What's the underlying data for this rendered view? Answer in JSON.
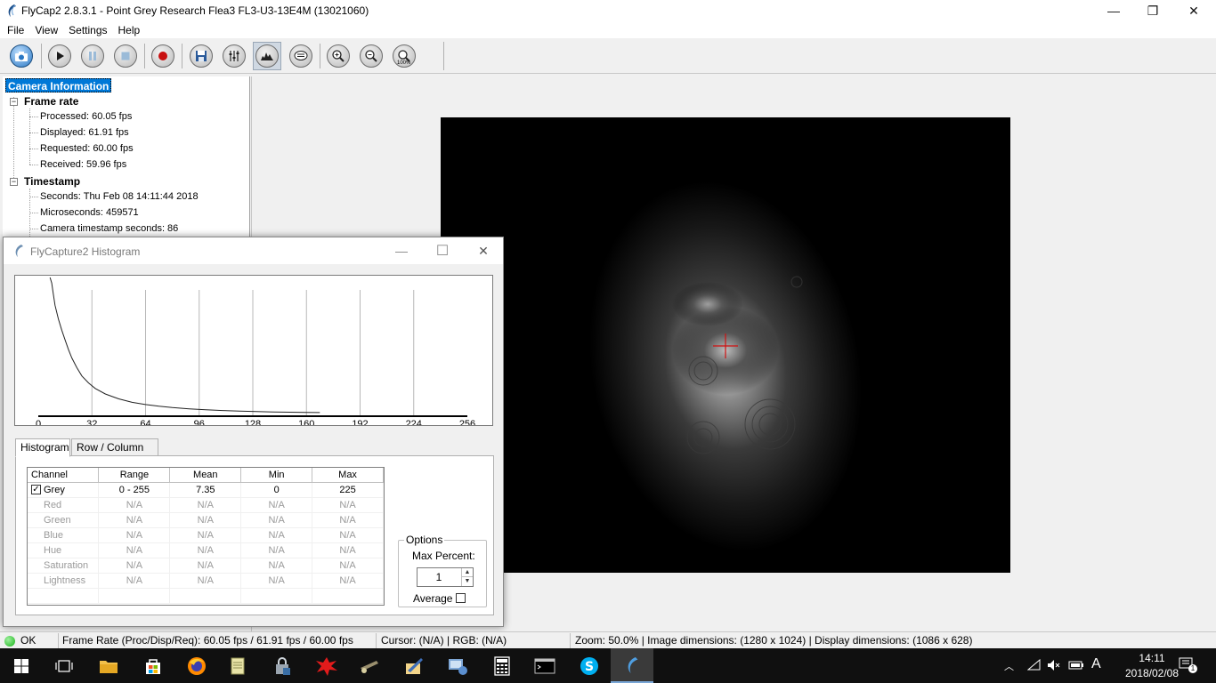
{
  "window": {
    "title": "FlyCap2 2.8.3.1 - Point Grey Research Flea3 FL3-U3-13E4M (13021060)",
    "minimize": "—",
    "maximize": "❐",
    "close": "✕"
  },
  "menu": [
    "File",
    "View",
    "Settings",
    "Help"
  ],
  "toolbar": [
    "camera-select",
    "start",
    "pause",
    "stop",
    "record",
    "save",
    "settings",
    "histogram",
    "event-stats",
    "zoom-in",
    "zoom-out",
    "zoom-100"
  ],
  "zoom100_label": "100%",
  "tree": {
    "root": "Camera Information",
    "frame_rate": {
      "label": "Frame rate",
      "items": [
        "Processed: 60.05 fps",
        "Displayed: 61.91 fps",
        "Requested: 60.00 fps",
        "Received: 59.96 fps"
      ]
    },
    "timestamp": {
      "label": "Timestamp",
      "items": [
        "Seconds: Thu Feb 08 14:11:44 2018",
        "Microseconds: 459571",
        "Camera timestamp seconds: 86"
      ]
    },
    "expanded_symbol": "−"
  },
  "histogram": {
    "title": "FlyCapture2 Histogram",
    "tabs": [
      "Histogram",
      "Row / Column Plot"
    ],
    "columns": [
      "Channel",
      "Range",
      "Mean",
      "Min",
      "Max"
    ],
    "rows": [
      {
        "channel": "Grey",
        "range": "0 - 255",
        "mean": "7.35",
        "min": "0",
        "max": "225",
        "checked": true
      },
      {
        "channel": "Red",
        "range": "N/A",
        "mean": "N/A",
        "min": "N/A",
        "max": "N/A"
      },
      {
        "channel": "Green",
        "range": "N/A",
        "mean": "N/A",
        "min": "N/A",
        "max": "N/A"
      },
      {
        "channel": "Blue",
        "range": "N/A",
        "mean": "N/A",
        "min": "N/A",
        "max": "N/A"
      },
      {
        "channel": "Hue",
        "range": "N/A",
        "mean": "N/A",
        "min": "N/A",
        "max": "N/A"
      },
      {
        "channel": "Saturation",
        "range": "N/A",
        "mean": "N/A",
        "min": "N/A",
        "max": "N/A"
      },
      {
        "channel": "Lightness",
        "range": "N/A",
        "mean": "N/A",
        "min": "N/A",
        "max": "N/A"
      }
    ],
    "checkmark": "✓",
    "options": {
      "legend": "Options",
      "max_percent_label": "Max Percent:",
      "max_percent_value": "1",
      "average_label": "Average"
    }
  },
  "chart_data": {
    "type": "line",
    "xlim": [
      0,
      256
    ],
    "x_ticks": [
      "0",
      "32",
      "64",
      "96",
      "128",
      "160",
      "192",
      "224",
      "256"
    ],
    "grid": "vertical",
    "series": [
      {
        "x": [
          7,
          8,
          9,
          10,
          12,
          14,
          16,
          18,
          20,
          23,
          26,
          30,
          34,
          40,
          48,
          56,
          64,
          72,
          80,
          90,
          100,
          110,
          120,
          130,
          140,
          150,
          160,
          168
        ],
        "y": [
          100,
          96,
          88,
          80,
          70,
          62,
          55,
          48,
          42,
          35,
          29,
          24,
          20,
          16,
          12.5,
          10,
          8.4,
          7.2,
          6.2,
          5.3,
          4.6,
          4.1,
          3.7,
          3.4,
          3.1,
          2.9,
          2.7,
          2.6
        ]
      }
    ]
  },
  "status": {
    "ok": "OK",
    "frame_rate": "Frame Rate (Proc/Disp/Req): 60.05 fps / 61.91 fps / 60.00 fps",
    "cursor": "Cursor: (N/A) | RGB: (N/A)",
    "zoom": "Zoom: 50.0% | Image dimensions: (1280 x 1024) | Display dimensions: (1086 x 628)"
  },
  "taskbar": {
    "apps": [
      "start",
      "task-view",
      "file-explorer",
      "store",
      "firefox",
      "notepad",
      "security",
      "sketch",
      "paint",
      "drawing",
      "network",
      "calculator",
      "terminal",
      "skype",
      "flycap"
    ],
    "time": "14:11",
    "date": "2018/02/08",
    "ime": "A",
    "notification_count": "1"
  },
  "colors": {
    "selection": "#0078d7",
    "crosshair": "#d01010",
    "status_ok": "#18b418",
    "taskbar": "#101010"
  }
}
